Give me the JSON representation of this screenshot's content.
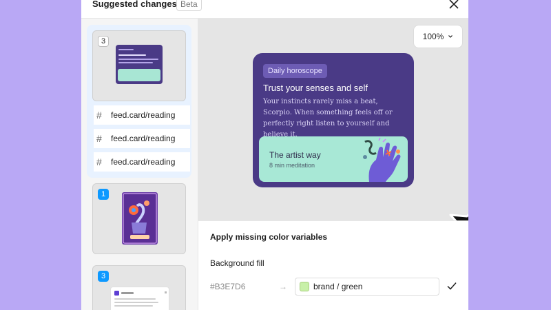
{
  "header": {
    "title": "Suggested changes",
    "badge": "Beta"
  },
  "sidebar": {
    "groups": [
      {
        "count": "3",
        "layers": [
          "feed.card/reading",
          "feed.card/reading",
          "feed.card/reading"
        ]
      },
      {
        "count": "1"
      },
      {
        "count": "3"
      }
    ]
  },
  "canvas": {
    "zoom": "100%",
    "card": {
      "tag": "Daily horoscope",
      "title": "Trust your senses and self",
      "body": "Your instincts rarely miss a beat, Scorpio. When something feels off or perfectly right listen to yourself and believe it.",
      "inner_title": "The artist way",
      "inner_sub": "8 min meditation"
    }
  },
  "fix": {
    "title": "Apply missing color variables",
    "label": "Background fill",
    "hex": "#B3E7D6",
    "variable": "brand / green",
    "swatch_color": "#c8f0a8"
  },
  "colors": {
    "background": "#b9a8f5",
    "card": "#4a3a86",
    "card_inner": "#a8e8d6",
    "accent_blue": "#0d99ff"
  }
}
